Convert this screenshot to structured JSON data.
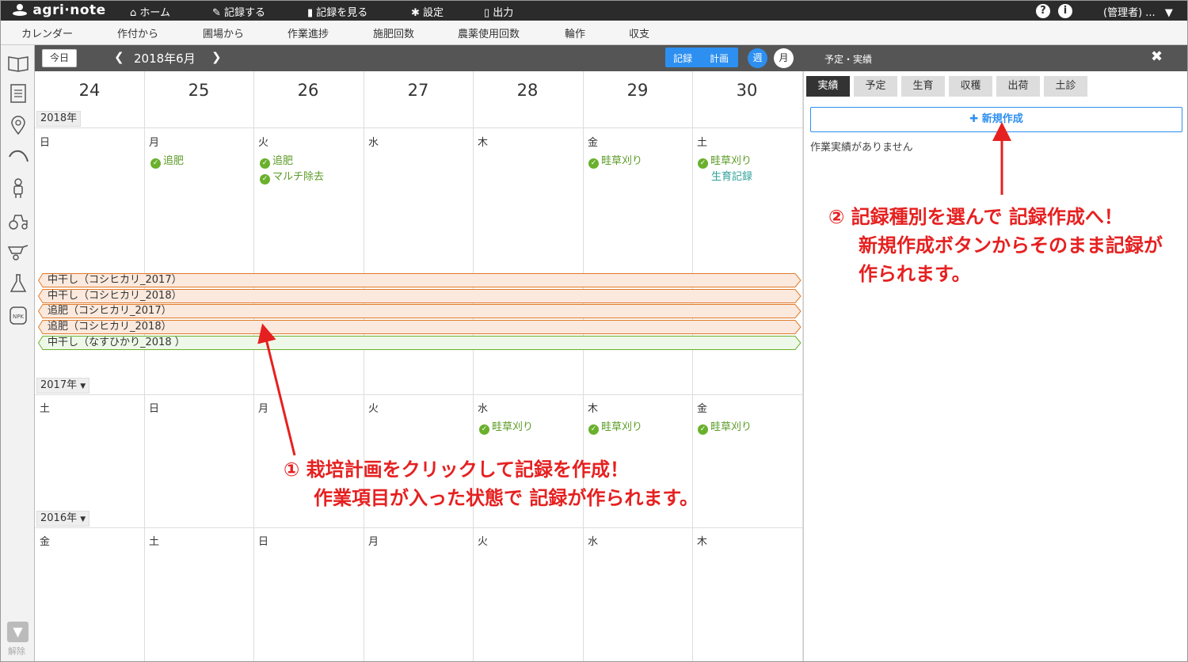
{
  "app": {
    "logo": "agri·note"
  },
  "topnav": {
    "home": "ホーム",
    "record": "記録する",
    "view": "記録を見る",
    "settings": "設定",
    "output": "出力",
    "help": "?",
    "info": "i",
    "user": "(管理者) ..."
  },
  "subnav": [
    "カレンダー",
    "作付から",
    "圃場から",
    "作業進捗",
    "施肥回数",
    "農薬使用回数",
    "輪作",
    "収支"
  ],
  "calendar": {
    "today": "今日",
    "title": "2018年6月",
    "record_label": "記録",
    "plan_label": "計画",
    "week_label": "週",
    "month_label": "月",
    "day_numbers": [
      "24",
      "25",
      "26",
      "27",
      "28",
      "29",
      "30"
    ],
    "sections": [
      {
        "year": "2018年",
        "weekdays": [
          "日",
          "月",
          "火",
          "水",
          "木",
          "金",
          "土"
        ]
      },
      {
        "year": "2017年",
        "weekdays": [
          "土",
          "日",
          "月",
          "火",
          "水",
          "木",
          "金"
        ]
      },
      {
        "year": "2016年",
        "weekdays": [
          "金",
          "土",
          "日",
          "月",
          "火",
          "水",
          "木"
        ]
      }
    ],
    "events_2018": [
      {
        "col": 1,
        "row": 0,
        "label": "追肥",
        "check": true
      },
      {
        "col": 2,
        "row": 0,
        "label": "追肥",
        "check": true
      },
      {
        "col": 2,
        "row": 1,
        "label": "マルチ除去",
        "check": true
      },
      {
        "col": 5,
        "row": 0,
        "label": "畦草刈り",
        "check": true
      },
      {
        "col": 6,
        "row": 0,
        "label": "畦草刈り",
        "check": true
      },
      {
        "col": 6,
        "row": 1,
        "label": "生育記録",
        "check": false
      }
    ],
    "events_2017": [
      {
        "col": 4,
        "row": 0,
        "label": "畦草刈り",
        "check": true
      },
      {
        "col": 5,
        "row": 0,
        "label": "畦草刈り",
        "check": true
      },
      {
        "col": 6,
        "row": 0,
        "label": "畦草刈り",
        "check": true
      }
    ],
    "plans": [
      {
        "label": "中干し（コシヒカリ_2017）",
        "color": "orange"
      },
      {
        "label": "中干し（コシヒカリ_2018）",
        "color": "orange"
      },
      {
        "label": "追肥（コシヒカリ_2017）",
        "color": "orange"
      },
      {
        "label": "追肥（コシヒカリ_2018）",
        "color": "orange"
      },
      {
        "label": "中干し（なすひかり_2018 ）",
        "color": "green"
      }
    ]
  },
  "panel": {
    "title": "予定・実績",
    "close": "✖",
    "tabs": [
      "実績",
      "予定",
      "生育",
      "収穫",
      "出荷",
      "土診"
    ],
    "active_tab": "実績",
    "new_button": "新規作成",
    "empty": "作業実績がありません"
  },
  "sidebar": {
    "filter_label": "解除"
  },
  "annotations": {
    "a1_line1": "① 栽培計画をクリックして記録を作成！",
    "a1_line2": "作業項目が入った状態で 記録が作られます。",
    "a2_line1": "② 記録種別を選んで 記録作成へ！",
    "a2_line2": "新規作成ボタンからそのまま記録が",
    "a2_line3": "作られます。"
  },
  "colors": {
    "accent": "#2d8ff0",
    "annotation": "#e62020",
    "check": "#6ab02c",
    "plan_orange_fill": "#fbe9dd",
    "plan_orange_border": "#e07a2b",
    "plan_green_fill": "#eef8e8",
    "plan_green_border": "#6ab02c"
  }
}
